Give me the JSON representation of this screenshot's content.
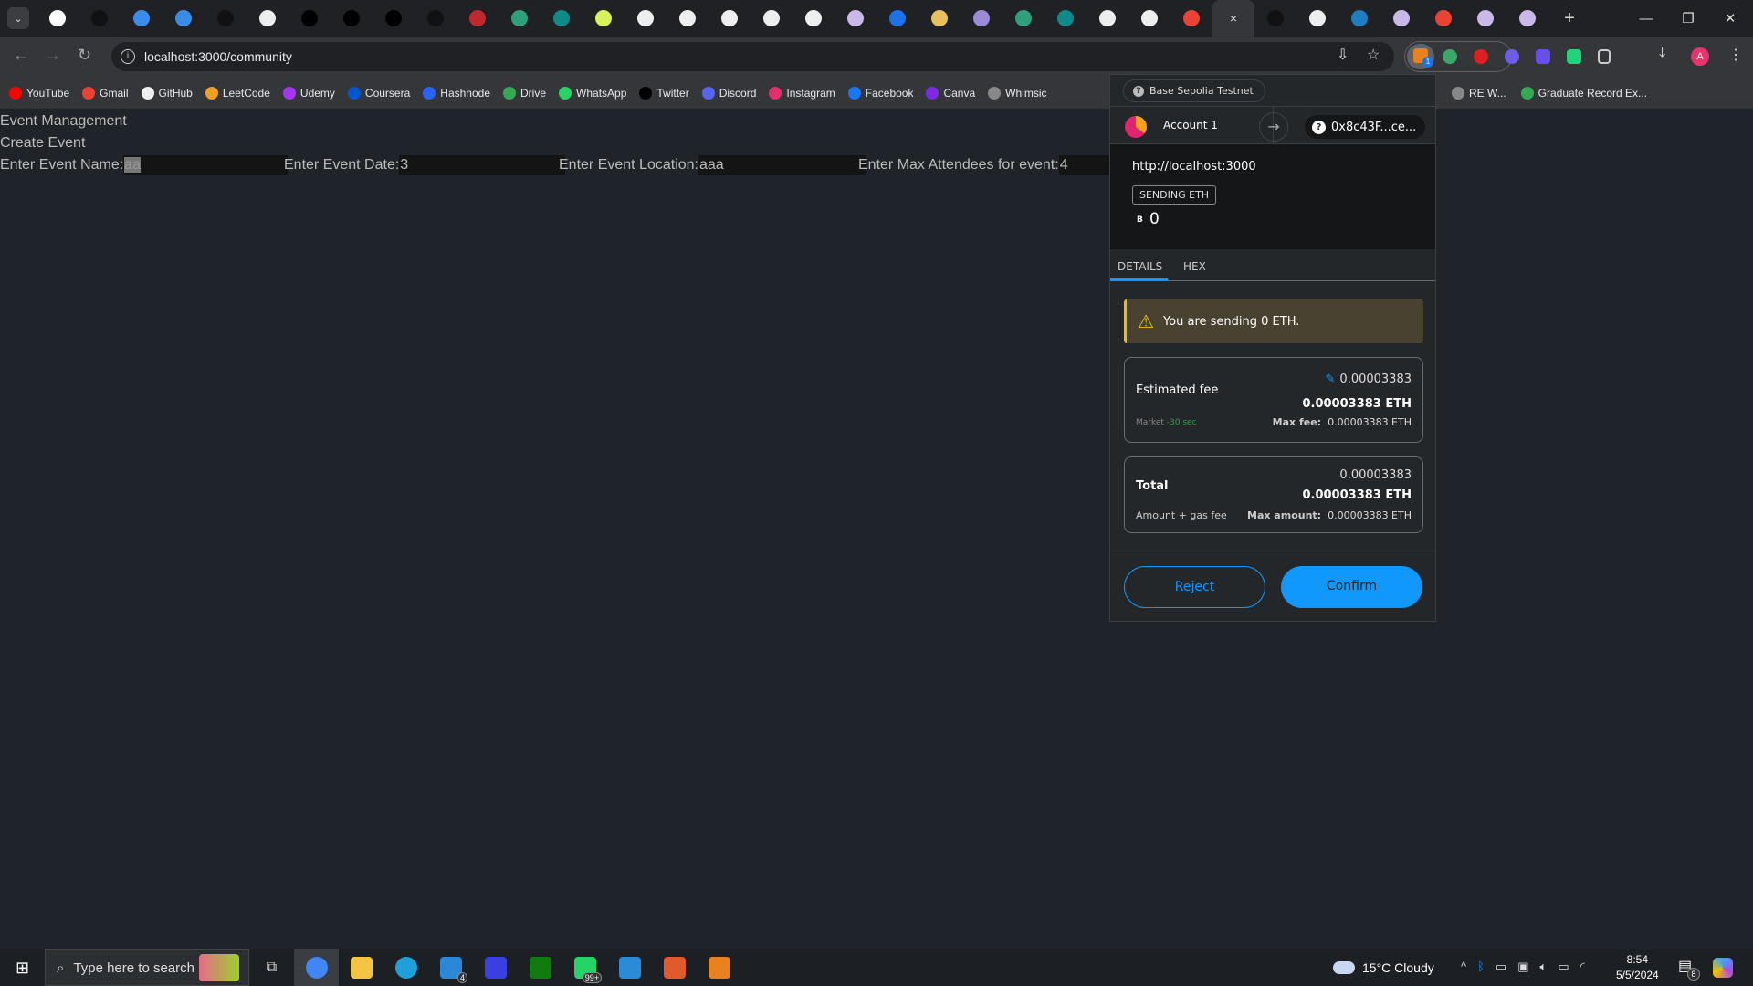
{
  "browser": {
    "tabs": [
      {
        "icon": "tab-favicon-1",
        "color": "#ffffff"
      },
      {
        "icon": "tab-favicon-2",
        "color": "#111111"
      },
      {
        "icon": "tab-favicon-3",
        "color": "#3b8beb"
      },
      {
        "icon": "tab-favicon-4",
        "color": "#3b8beb"
      },
      {
        "icon": "tab-favicon-5",
        "color": "#111111"
      },
      {
        "icon": "github-icon",
        "color": "#eeeeee"
      },
      {
        "icon": "notion-icon",
        "color": "#000000"
      },
      {
        "icon": "notion-icon",
        "color": "#000000"
      },
      {
        "icon": "notion-icon",
        "color": "#000000"
      },
      {
        "icon": "tab-favicon-6",
        "color": "#111111"
      },
      {
        "icon": "tab-favicon-7",
        "color": "#c0282b"
      },
      {
        "icon": "earth-icon",
        "color": "#2ea07b"
      },
      {
        "icon": "tab-favicon-8",
        "color": "#0f8a8a"
      },
      {
        "icon": "tab-favicon-9",
        "color": "#d8f35a"
      },
      {
        "icon": "github-icon",
        "color": "#eeeeee"
      },
      {
        "icon": "feather-icon",
        "color": "#eeeeee"
      },
      {
        "icon": "feather-icon",
        "color": "#eeeeee"
      },
      {
        "icon": "github-icon",
        "color": "#eeeeee"
      },
      {
        "icon": "feather-icon",
        "color": "#eeeeee"
      },
      {
        "icon": "tab-favicon-10",
        "color": "#c9b8e8"
      },
      {
        "icon": "tab-favicon-11",
        "color": "#1a73e8"
      },
      {
        "icon": "tab-favicon-12",
        "color": "#e8c15a"
      },
      {
        "icon": "tab-favicon-13",
        "color": "#9b8ad8"
      },
      {
        "icon": "earth-icon",
        "color": "#2ea07b"
      },
      {
        "icon": "tab-favicon-8",
        "color": "#0f8a8a"
      },
      {
        "icon": "github-icon",
        "color": "#eeeeee"
      },
      {
        "icon": "github-icon",
        "color": "#eeeeee"
      },
      {
        "icon": "gmail-icon",
        "color": "#ea4335"
      }
    ],
    "active_tab_close": "×",
    "tabs_after": [
      {
        "icon": "tab-favicon-2",
        "color": "#111111"
      },
      {
        "icon": "github-icon",
        "color": "#eeeeee"
      },
      {
        "icon": "tab-favicon-14",
        "color": "#1d7fc2"
      },
      {
        "icon": "tab-favicon-10",
        "color": "#c9b8e8"
      },
      {
        "icon": "gmail-icon",
        "color": "#ea4335"
      },
      {
        "icon": "tab-favicon-10",
        "color": "#c9b8e8"
      },
      {
        "icon": "tab-favicon-10",
        "color": "#c9b8e8"
      }
    ],
    "new_tab": "+",
    "url": "localhost:3000/community",
    "profile_initial": "A",
    "extension_badge": "1",
    "bookmarks": [
      {
        "label": "YouTube",
        "color": "#ff0000"
      },
      {
        "label": "Gmail",
        "color": "#ea4335"
      },
      {
        "label": "GitHub",
        "color": "#eeeeee"
      },
      {
        "label": "LeetCode",
        "color": "#f0a020"
      },
      {
        "label": "Udemy",
        "color": "#a435f0"
      },
      {
        "label": "Coursera",
        "color": "#0056d2"
      },
      {
        "label": "Hashnode",
        "color": "#2962ff"
      },
      {
        "label": "Drive",
        "color": "#34a853"
      },
      {
        "label": "WhatsApp",
        "color": "#25d366"
      },
      {
        "label": "Twitter",
        "color": "#000000"
      },
      {
        "label": "Discord",
        "color": "#5865f2"
      },
      {
        "label": "Instagram",
        "color": "#e1306c"
      },
      {
        "label": "Facebook",
        "color": "#1877f2"
      },
      {
        "label": "Canva",
        "color": "#7d2ae8"
      },
      {
        "label": "Whimsic",
        "color": "#888888"
      }
    ],
    "bookmarks_right": [
      {
        "label": "RE W...",
        "color": "#888888"
      },
      {
        "label": "Graduate Record Ex...",
        "color": "#34a853"
      }
    ]
  },
  "page": {
    "title": "Event Management",
    "subtitle": "Create Event",
    "fields": [
      {
        "label": "Enter Event Name:",
        "value": "aa"
      },
      {
        "label": "Enter Event Date:",
        "value": "3"
      },
      {
        "label": "Enter Event Location:",
        "value": "aaa"
      },
      {
        "label": "Enter Max Attendees for event:",
        "value": "4"
      }
    ]
  },
  "metamask": {
    "network": "Base Sepolia Testnet",
    "account": "Account 1",
    "to_address": "0x8c43F...ce...",
    "origin": "http://localhost:3000",
    "action": "SENDING ETH",
    "currency_symbol": "B",
    "amount": "0",
    "tabs": [
      "DETAILS",
      "HEX"
    ],
    "active_tab": "DETAILS",
    "warning": "You are sending 0 ETH.",
    "fee": {
      "label": "Estimated fee",
      "value": "0.00003383",
      "value_eth": "0.00003383 ETH",
      "speed": "Market",
      "time": "-30 sec",
      "max_label": "Max fee:",
      "max_value": "0.00003383 ETH"
    },
    "total": {
      "label": "Total",
      "value": "0.00003383",
      "value_eth": "0.00003383 ETH",
      "sub": "Amount + gas fee",
      "max_label": "Max amount:",
      "max_value": "0.00003383 ETH"
    },
    "reject": "Reject",
    "confirm": "Confirm",
    "accent": "#1098fc"
  },
  "taskbar": {
    "search_placeholder": "Type here to search",
    "apps": [
      {
        "name": "chrome",
        "color": "#4285f4"
      },
      {
        "name": "file-explorer",
        "color": "#f4c542"
      },
      {
        "name": "edge",
        "color": "#1fa0d8"
      },
      {
        "name": "mail",
        "color": "#2b88d8",
        "badge": "4"
      },
      {
        "name": "app-blue",
        "color": "#3a3fe0"
      },
      {
        "name": "xbox",
        "color": "#107c10"
      },
      {
        "name": "whatsapp",
        "color": "#25d366",
        "badge": "99+"
      },
      {
        "name": "vscode",
        "color": "#2a8bd8"
      },
      {
        "name": "snipping-tool",
        "color": "#e05a2b"
      },
      {
        "name": "metamask",
        "color": "#e8821e"
      }
    ],
    "weather": "15°C  Cloudy",
    "time": "8:54",
    "date": "5/5/2024",
    "notifications": "8"
  }
}
